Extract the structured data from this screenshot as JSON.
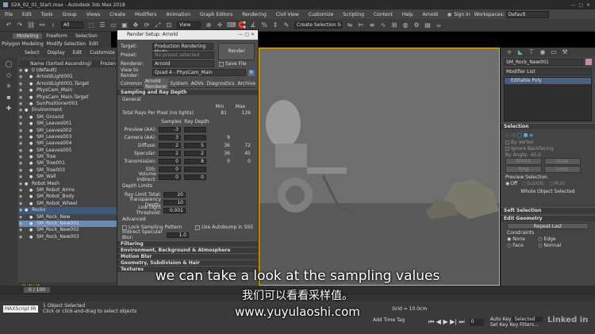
{
  "window": {
    "title": "S2A_02_01_Start.max - Autodesk 3ds Max 2018",
    "sign_in": "Sign in",
    "workspaces_label": "Workspaces:",
    "workspaces_value": "Default"
  },
  "menu": [
    "File",
    "Edit",
    "Tools",
    "Group",
    "Views",
    "Create",
    "Modifiers",
    "Animation",
    "Graph Editors",
    "Rendering",
    "Civil View",
    "Customize",
    "Scripting",
    "Content",
    "Help",
    "Arnold"
  ],
  "toolbar": {
    "filter": "All",
    "view": "View",
    "selection_set": "Create Selection Se"
  },
  "ribbon": {
    "tabs": [
      "Modeling",
      "Freeform",
      "Selection"
    ],
    "sub": [
      "Polygon Modeling",
      "Modify Selection",
      "Edit",
      "Geometry"
    ]
  },
  "scene_explorer": {
    "tabs": [
      "Select",
      "Display",
      "Edit",
      "Customize"
    ],
    "header": "Name (Sorted Ascending)",
    "header2": "Frozen",
    "rows": [
      "0 (default)",
      "ArnoldLight001",
      "ArnoldLight001.Target",
      "PhysCam_Main",
      "PhysCam_Main.Target",
      "SunPositioner001",
      "Environment",
      "SM_Ground",
      "SM_Leaves001",
      "SM_Leaves002",
      "SM_Leaves003",
      "SM_Leaves004",
      "SM_Leaves005",
      "SM_Tree",
      "SM_Tree001",
      "SM_Tree003",
      "SM_Wall",
      "Robot Mesh",
      "SM_Robot_Arms",
      "SM_Robot_Body",
      "SM_Robot_Wheel",
      "Rocks",
      "SM_Rock_New",
      "SM_Rock_New001",
      "SM_Rock_New002",
      "SM_Rock_New003"
    ],
    "layer": "Default"
  },
  "render_setup": {
    "title": "Render Setup: Arnold",
    "target_label": "Target:",
    "target_value": "Production Rendering Mode",
    "preset_label": "Preset:",
    "preset_value": "No preset selected",
    "renderer_label": "Renderer:",
    "renderer_value": "Arnold",
    "save_file": "Save File",
    "view_label": "View to Render:",
    "view_value": "Quad 4 - PhysCam_Main",
    "render_button": "Render",
    "tabs": [
      "Common",
      "Arnold Renderer",
      "System",
      "AOVs",
      "Diagnostics",
      "Archive"
    ],
    "rollout_sampling": "Sampling and Ray Depth",
    "general": "General",
    "min": "Min",
    "max": "Max",
    "total_rays_label": "Total Rays Per Pixel (no lights)",
    "total_rays_min": "81",
    "total_rays_max": "126",
    "samples": "Samples",
    "ray_depth": "Ray Depth",
    "rows": [
      {
        "label": "Preview (AA):",
        "samples": "-3",
        "depth": "",
        "min": "",
        "max": ""
      },
      {
        "label": "Camera (AA):",
        "samples": "3",
        "depth": "",
        "min": "9",
        "max": ""
      },
      {
        "label": "Diffuse:",
        "samples": "2",
        "depth": "5",
        "min": "36",
        "max": "72"
      },
      {
        "label": "Specular:",
        "samples": "2",
        "depth": "2",
        "min": "36",
        "max": "45"
      },
      {
        "label": "Transmission:",
        "samples": "0",
        "depth": "8",
        "min": "0",
        "max": "0"
      },
      {
        "label": "SSS:",
        "samples": "0",
        "depth": "",
        "min": "",
        "max": ""
      },
      {
        "label": "Volume Indirect:",
        "samples": "0",
        "depth": "0",
        "min": "",
        "max": ""
      }
    ],
    "depth_limits": "Depth Limits",
    "ray_limit_label": "Ray Limit Total:",
    "ray_limit": "20",
    "transparency_label": "Transparency Depth:",
    "transparency": "10",
    "low_light_label": "Low Light Threshold:",
    "low_light": "0.001",
    "advanced": "Advanced",
    "lock_sampling": "Lock Sampling Pattern",
    "autobump": "Use Autobump in SSS",
    "indirect_label": "Indirect Specular Blur:",
    "indirect": "1.0",
    "rollouts": [
      "Filtering",
      "Environment, Background & Atmosphere",
      "Motion Blur",
      "Geometry, Subdivision & Hair",
      "Textures"
    ]
  },
  "command_panel": {
    "object_name": "SM_Rock_New001",
    "modifier_list": "Modifier List",
    "stack_item": "Editable Poly",
    "selection": "Selection",
    "by_vertex": "By Vertex",
    "ignore_backfacing": "Ignore Backfacing",
    "by_angle_label": "By Angle:",
    "by_angle": "45.0",
    "shrink": "Shrink",
    "grow": "Grow",
    "ring": "Ring",
    "loop": "Loop",
    "preview_selection": "Preview Selection",
    "off": "Off",
    "subobj": "SubObj",
    "multi": "Multi",
    "whole_object": "Whole Object Selected",
    "soft_selection": "Soft Selection",
    "edit_geometry": "Edit Geometry",
    "repeat_last": "Repeat Last",
    "constraints": "Constraints",
    "none": "None",
    "edge": "Edge",
    "face": "Face",
    "normal": "Normal"
  },
  "status": {
    "frame": "0 / 100",
    "objects": "1 Object Selected",
    "hint": "Click or click-and-drag to select objects",
    "maxscript": "MAXScript Mi",
    "grid": "Grid = 10.0cm",
    "add_time_tag": "Add Time Tag",
    "auto_key": "Auto Key",
    "selected": "Selected",
    "set_key": "Set Key",
    "key_filters": "Key Filters...",
    "frame_num": "0"
  },
  "subtitles": {
    "english": "we can take a look at the sampling values",
    "chinese": "我们可以看看采样值。",
    "url": "www.yuyulaoshi.com"
  },
  "watermark": "Linked in"
}
